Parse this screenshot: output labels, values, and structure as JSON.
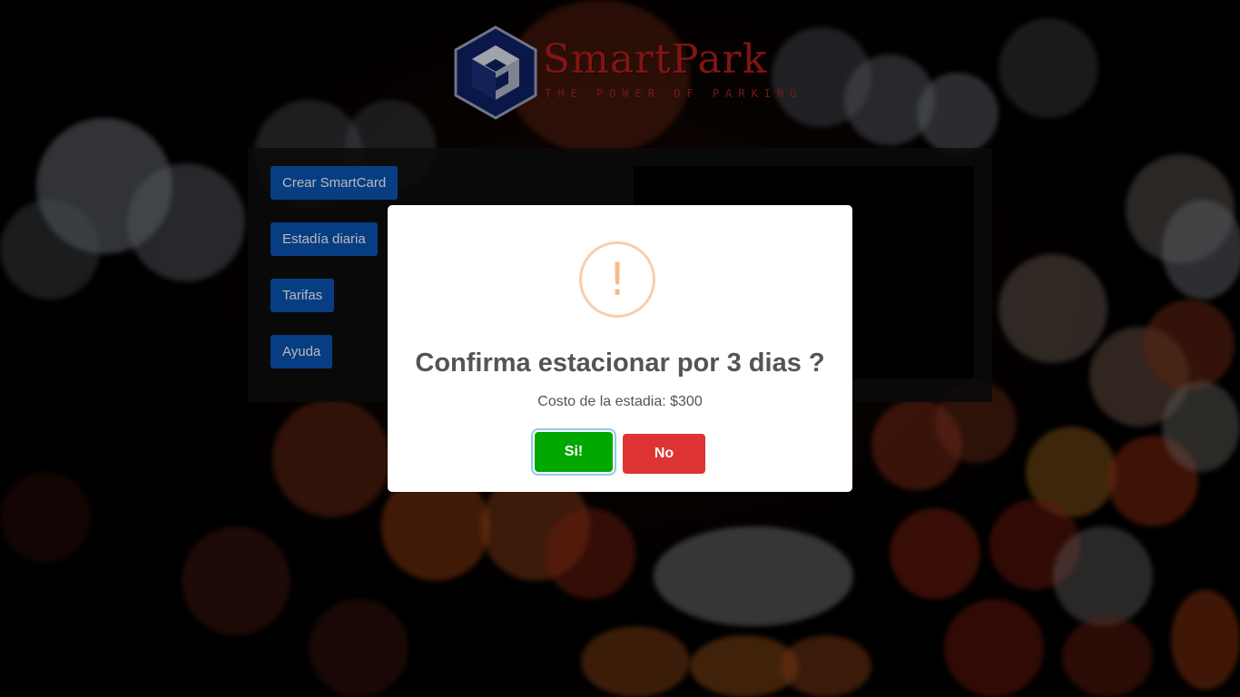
{
  "logo": {
    "title": "SmartPark",
    "subtitle": "THE POWER OF PARKING",
    "icon": "cube-hexagon-logo"
  },
  "menu": {
    "items": [
      {
        "label": "Crear SmartCard"
      },
      {
        "label": "Estadía diaria"
      },
      {
        "label": "Tarifas"
      },
      {
        "label": "Ayuda"
      }
    ]
  },
  "dialog": {
    "icon": "warning-icon",
    "icon_glyph": "!",
    "title": "Confirma estacionar por 3 dias ?",
    "text": "Costo de la estadia: $300",
    "confirm_label": "Si!",
    "cancel_label": "No"
  },
  "colors": {
    "menu_button": "#0b57b6",
    "confirm": "#00a800",
    "cancel": "#dd3333",
    "warning": "#f8bb86",
    "brand": "#b51d1d"
  }
}
